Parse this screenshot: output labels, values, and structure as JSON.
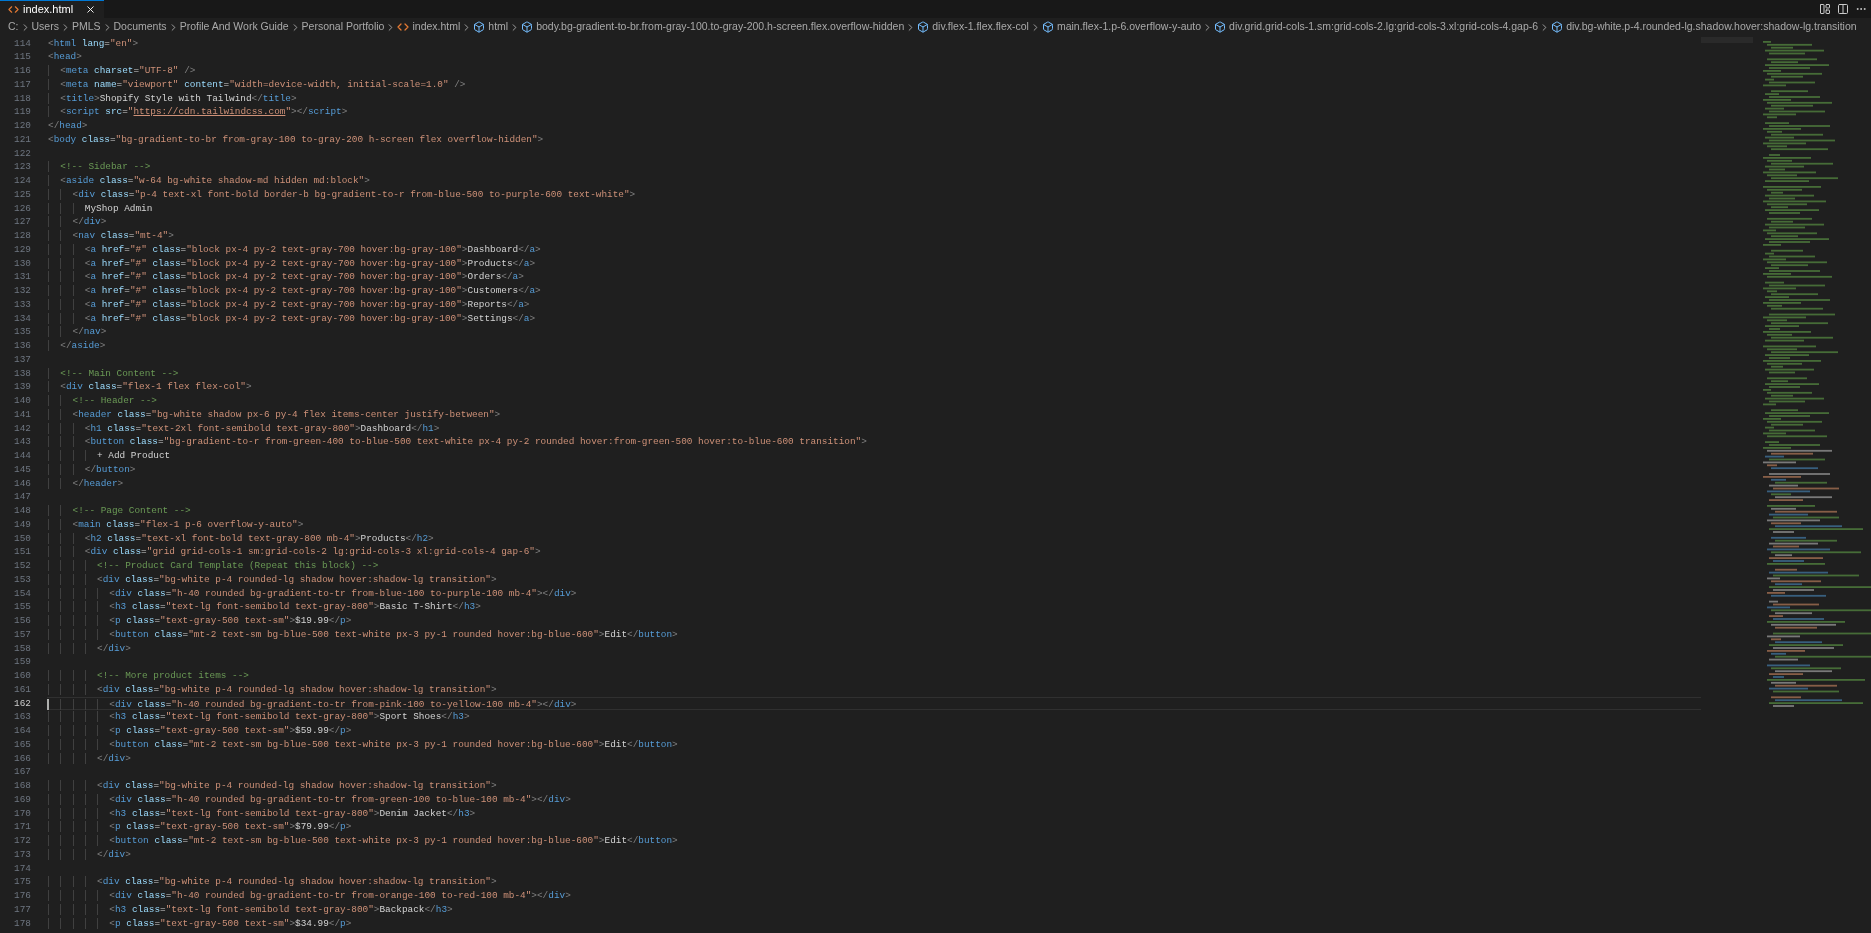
{
  "tabs": [
    {
      "label": "index.html",
      "selected": true
    }
  ],
  "breadcrumbs": [
    {
      "label": "C:",
      "kind": "folder"
    },
    {
      "label": "Users",
      "kind": "folder"
    },
    {
      "label": "PMLS",
      "kind": "folder"
    },
    {
      "label": "Documents",
      "kind": "folder"
    },
    {
      "label": "Profile And Work Guide",
      "kind": "folder"
    },
    {
      "label": "Personal Portfolio",
      "kind": "folder"
    },
    {
      "label": "index.html",
      "kind": "file"
    },
    {
      "label": "html",
      "kind": "element"
    },
    {
      "label": "body.bg-gradient-to-br.from-gray-100.to-gray-200.h-screen.flex.overflow-hidden",
      "kind": "element"
    },
    {
      "label": "div.flex-1.flex.flex-col",
      "kind": "element"
    },
    {
      "label": "main.flex-1.p-6.overflow-y-auto",
      "kind": "element"
    },
    {
      "label": "div.grid.grid-cols-1.sm:grid-cols-2.lg:grid-cols-3.xl:grid-cols-4.gap-6",
      "kind": "element"
    },
    {
      "label": "div.bg-white.p-4.rounded-lg.shadow.hover:shadow-lg.transition",
      "kind": "element"
    }
  ],
  "editor": {
    "lines": [
      {
        "number": "114",
        "code": "<html lang=\"en\">",
        "selected": false
      },
      {
        "number": "115",
        "code": "<head>",
        "selected": false
      },
      {
        "number": "116",
        "code": "  <meta charset=\"UTF-8\" />",
        "selected": false
      },
      {
        "number": "117",
        "code": "  <meta name=\"viewport\" content=\"width=device-width, initial-scale=1.0\" />",
        "selected": false
      },
      {
        "number": "118",
        "code": "  <title>Shopify Style with Tailwind</title>",
        "selected": false
      },
      {
        "number": "119",
        "code": "  <script src=\"https://cdn.tailwindcss.com\"></script>",
        "selected": false
      },
      {
        "number": "120",
        "code": "</head>",
        "selected": false
      },
      {
        "number": "121",
        "code": "<body class=\"bg-gradient-to-br from-gray-100 to-gray-200 h-screen flex overflow-hidden\">",
        "selected": false
      },
      {
        "number": "122",
        "selected": false
      },
      {
        "number": "123",
        "code": "  <!-- Sidebar -->",
        "selected": false
      },
      {
        "number": "124",
        "code": "  <aside class=\"w-64 bg-white shadow-md hidden md:block\">",
        "selected": false
      },
      {
        "number": "125",
        "code": "    <div class=\"p-4 text-xl font-bold border-b bg-gradient-to-r from-blue-500 to-purple-600 text-white\">",
        "selected": false
      },
      {
        "number": "126",
        "code": "      MyShop Admin",
        "selected": false
      },
      {
        "number": "127",
        "code": "    </div>",
        "selected": false
      },
      {
        "number": "128",
        "code": "    <nav class=\"mt-4\">",
        "selected": false
      },
      {
        "number": "129",
        "code": "      <a href=\"#\" class=\"block px-4 py-2 text-gray-700 hover:bg-gray-100\">Dashboard</a>",
        "selected": false
      },
      {
        "number": "130",
        "code": "      <a href=\"#\" class=\"block px-4 py-2 text-gray-700 hover:bg-gray-100\">Products</a>",
        "selected": false
      },
      {
        "number": "131",
        "code": "      <a href=\"#\" class=\"block px-4 py-2 text-gray-700 hover:bg-gray-100\">Orders</a>",
        "selected": false
      },
      {
        "number": "132",
        "code": "      <a href=\"#\" class=\"block px-4 py-2 text-gray-700 hover:bg-gray-100\">Customers</a>",
        "selected": false
      },
      {
        "number": "133",
        "code": "      <a href=\"#\" class=\"block px-4 py-2 text-gray-700 hover:bg-gray-100\">Reports</a>",
        "selected": false
      },
      {
        "number": "134",
        "code": "      <a href=\"#\" class=\"block px-4 py-2 text-gray-700 hover:bg-gray-100\">Settings</a>",
        "selected": false
      },
      {
        "number": "135",
        "code": "    </nav>",
        "selected": false
      },
      {
        "number": "136",
        "code": "  </aside>",
        "selected": false
      },
      {
        "number": "137",
        "selected": false
      },
      {
        "number": "138",
        "code": "  <!-- Main Content -->",
        "selected": false
      },
      {
        "number": "139",
        "code": "  <div class=\"flex-1 flex flex-col\">",
        "selected": false
      },
      {
        "number": "140",
        "code": "    <!-- Header -->",
        "selected": false
      },
      {
        "number": "141",
        "code": "    <header class=\"bg-white shadow px-6 py-4 flex items-center justify-between\">",
        "selected": false
      },
      {
        "number": "142",
        "code": "      <h1 class=\"text-2xl font-semibold text-gray-800\">Dashboard</h1>",
        "selected": false
      },
      {
        "number": "143",
        "code": "      <button class=\"bg-gradient-to-r from-green-400 to-blue-500 text-white px-4 py-2 rounded hover:from-green-500 hover:to-blue-600 transition\">",
        "selected": false
      },
      {
        "number": "144",
        "code": "        + Add Product",
        "selected": false
      },
      {
        "number": "145",
        "code": "      </button>",
        "selected": false
      },
      {
        "number": "146",
        "code": "    </header>",
        "selected": false
      },
      {
        "number": "147",
        "selected": false
      },
      {
        "number": "148",
        "code": "    <!-- Page Content -->",
        "selected": false
      },
      {
        "number": "149",
        "code": "    <main class=\"flex-1 p-6 overflow-y-auto\">",
        "selected": false
      },
      {
        "number": "150",
        "code": "      <h2 class=\"text-xl font-bold text-gray-800 mb-4\">Products</h2>",
        "selected": false
      },
      {
        "number": "151",
        "code": "      <div class=\"grid grid-cols-1 sm:grid-cols-2 lg:grid-cols-3 xl:grid-cols-4 gap-6\">",
        "selected": false
      },
      {
        "number": "152",
        "code": "        <!-- Product Card Template (Repeat this block) -->",
        "selected": false
      },
      {
        "number": "153",
        "code": "        <div class=\"bg-white p-4 rounded-lg shadow hover:shadow-lg transition\">",
        "selected": false
      },
      {
        "number": "154",
        "code": "          <div class=\"h-40 rounded bg-gradient-to-tr from-blue-100 to-purple-100 mb-4\"></div>",
        "selected": false
      },
      {
        "number": "155",
        "code": "          <h3 class=\"text-lg font-semibold text-gray-800\">Basic T-Shirt</h3>",
        "selected": false
      },
      {
        "number": "156",
        "code": "          <p class=\"text-gray-500 text-sm\">$19.99</p>",
        "selected": false
      },
      {
        "number": "157",
        "code": "          <button class=\"mt-2 text-sm bg-blue-500 text-white px-3 py-1 rounded hover:bg-blue-600\">Edit</button>",
        "selected": false
      },
      {
        "number": "158",
        "code": "        </div>",
        "selected": false
      },
      {
        "number": "159",
        "selected": false
      },
      {
        "number": "160",
        "code": "        <!-- More product items -->",
        "selected": false
      },
      {
        "number": "161",
        "code": "        <div class=\"bg-white p-4 rounded-lg shadow hover:shadow-lg transition\">",
        "selected": false
      },
      {
        "number": "162",
        "code": "          <div class=\"h-40 rounded bg-gradient-to-tr from-pink-100 to-yellow-100 mb-4\"></div>",
        "selected": true
      },
      {
        "number": "163",
        "code": "          <h3 class=\"text-lg font-semibold text-gray-800\">Sport Shoes</h3>",
        "selected": false
      },
      {
        "number": "164",
        "code": "          <p class=\"text-gray-500 text-sm\">$59.99</p>",
        "selected": false
      },
      {
        "number": "165",
        "code": "          <button class=\"mt-2 text-sm bg-blue-500 text-white px-3 py-1 rounded hover:bg-blue-600\">Edit</button>",
        "selected": false
      },
      {
        "number": "166",
        "code": "        </div>",
        "selected": false
      },
      {
        "number": "167",
        "selected": false
      },
      {
        "number": "168",
        "code": "        <div class=\"bg-white p-4 rounded-lg shadow hover:shadow-lg transition\">",
        "selected": false
      },
      {
        "number": "169",
        "code": "          <div class=\"h-40 rounded bg-gradient-to-tr from-green-100 to-blue-100 mb-4\"></div>",
        "selected": false
      },
      {
        "number": "170",
        "code": "          <h3 class=\"text-lg font-semibold text-gray-800\">Denim Jacket</h3>",
        "selected": false
      },
      {
        "number": "171",
        "code": "          <p class=\"text-gray-500 text-sm\">$79.99</p>",
        "selected": false
      },
      {
        "number": "172",
        "code": "          <button class=\"mt-2 text-sm bg-blue-500 text-white px-3 py-1 rounded hover:bg-blue-600\">Edit</button>",
        "selected": false
      },
      {
        "number": "173",
        "code": "        </div>",
        "selected": false
      },
      {
        "number": "174",
        "selected": false
      },
      {
        "number": "175",
        "code": "        <div class=\"bg-white p-4 rounded-lg shadow hover:shadow-lg transition\">",
        "selected": false
      },
      {
        "number": "176",
        "code": "          <div class=\"h-40 rounded bg-gradient-to-tr from-orange-100 to-red-100 mb-4\"></div>",
        "selected": false
      },
      {
        "number": "177",
        "code": "          <h3 class=\"text-lg font-semibold text-gray-800\">Backpack</h3>",
        "selected": false
      },
      {
        "number": "178",
        "code": "          <p class=\"text-gray-500 text-sm\">$34.99</p>",
        "selected": false
      }
    ]
  }
}
